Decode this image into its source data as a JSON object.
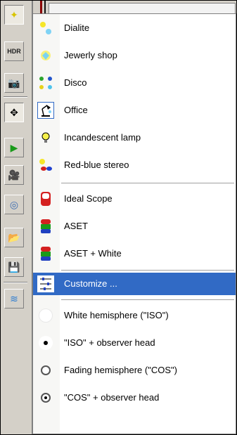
{
  "toolbar": {
    "hdr_label": "HDR",
    "buttons": [
      "lamp-dropdown-icon",
      "hdr-button",
      "camera-icon",
      "move-icon",
      "play-icon",
      "camera-settings-icon",
      "eye-scope-icon",
      "open-folder-icon",
      "save-disk-icon",
      "water-pattern-icon"
    ]
  },
  "menu": {
    "items": [
      {
        "label": "Dialite",
        "icon": "dialite-light-icon"
      },
      {
        "label": "Jewerly shop",
        "icon": "jewelry-light-icon"
      },
      {
        "label": "Disco",
        "icon": "disco-light-icon"
      },
      {
        "label": "Office",
        "icon": "desk-lamp-icon",
        "checked": true
      },
      {
        "label": "Incandescent lamp",
        "icon": "bulb-icon"
      },
      {
        "label": "Red-blue stereo",
        "icon": "stereo-glasses-icon"
      },
      {
        "label": "Ideal Scope",
        "icon": "ideal-scope-icon"
      },
      {
        "label": "ASET",
        "icon": "aset-icon"
      },
      {
        "label": "ASET + White",
        "icon": "aset-white-icon"
      },
      {
        "label": "Customize ...",
        "icon": "customize-icon",
        "selected": true
      },
      {
        "label": "White hemisphere (\"ISO\")",
        "icon": "white-hemisphere-icon"
      },
      {
        "label": "\"ISO\" + observer head",
        "icon": "iso-observer-icon"
      },
      {
        "label": "Fading hemisphere (\"COS\")",
        "icon": "fading-hemisphere-icon"
      },
      {
        "label": "\"COS\" + observer head",
        "icon": "cos-observer-icon"
      }
    ]
  },
  "colors": {
    "selection": "#316ac5",
    "toolbar": "#d4d0c8"
  }
}
